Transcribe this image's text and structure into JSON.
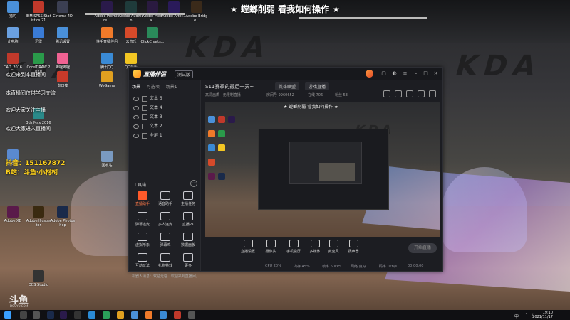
{
  "banner": "★ 螳螂削弱 看我如何操作 ★",
  "desktop_icons": [
    {
      "label": "猎豹",
      "color": "#4a90d9"
    },
    {
      "label": "IBM SPSS Statistics 21",
      "color": "#c0392b"
    },
    {
      "label": "Cinema 4D",
      "color": "#3b3f52"
    },
    {
      "label": "Adobe Premiere...",
      "color": "#2a1a4a"
    },
    {
      "label": "Adobe Audition",
      "color": "#1f3b3b"
    },
    {
      "label": "Adobe Media...",
      "color": "#2a1a40"
    },
    {
      "label": "Adobe After...",
      "color": "#2a1a5a"
    },
    {
      "label": "Adobe Bridge...",
      "color": "#3a2a1a"
    },
    {
      "label": "此电脑",
      "color": "#6aa0e0"
    },
    {
      "label": "迅雷",
      "color": "#3a7bd5"
    },
    {
      "label": "腾讯设置",
      "color": "#4a90d9"
    },
    {
      "label": "快手直播伴侣",
      "color": "#f07a2a"
    },
    {
      "label": "云音乐",
      "color": "#d64a2a"
    },
    {
      "label": "ClickCharts...",
      "color": "#2a8a5a"
    },
    {
      "label": "CAD_2016",
      "color": "#c0392b"
    },
    {
      "label": "CorelDRAW 2020",
      "color": "#2a9a4a"
    },
    {
      "label": "哔哩哔哩",
      "color": "#f06292"
    },
    {
      "label": "腾讯QQ",
      "color": "#3a8ad5"
    },
    {
      "label": "QQ音乐",
      "color": "#f3c623"
    },
    {
      "label": "3ds Max 2016",
      "color": "#2a8a8a"
    },
    {
      "label": "WeGame",
      "color": "#e0a020"
    },
    {
      "label": "向日葵",
      "color": "#c83a2a"
    },
    {
      "label": "计算机",
      "color": "#5a8ad0"
    },
    {
      "label": "回收站",
      "color": "#7a9ac0"
    },
    {
      "label": "Adobe XD",
      "color": "#5a1a4a"
    },
    {
      "label": "Adobe Illustrator",
      "color": "#3a2a10"
    },
    {
      "label": "Adobe Photoshop",
      "color": "#1a2a4a"
    },
    {
      "label": "OBS Studio",
      "color": "#333333"
    }
  ],
  "overlay": {
    "line1": "欢迎来到本直播间",
    "line2": "本直播间仅供学习交流",
    "line3": "欢迎大家关注主播",
    "line4": "欢迎大家进入直播间",
    "douyin": "抖音：151167872",
    "douyu_room": "B站：斗鱼·小柯柯"
  },
  "app": {
    "title": "直播伴侣",
    "version": "测试版",
    "left_tabs": [
      "场景",
      "可选项",
      "场景1"
    ],
    "add_label": "+",
    "scenes": [
      "文本 5",
      "文本 4",
      "文本 3",
      "文本 2",
      "全屏 1"
    ],
    "tools_header": "工具箱",
    "tools_more": "⋯",
    "tools": [
      {
        "label": "直播助手",
        "hot": true
      },
      {
        "label": "语音助手",
        "hot": false
      },
      {
        "label": "主播任务",
        "hot": false
      },
      {
        "label": "弹幕连麦",
        "hot": false
      },
      {
        "label": "多人连麦",
        "hot": false
      },
      {
        "label": "直播PK",
        "hot": false
      },
      {
        "label": "虚拟形象",
        "hot": false
      },
      {
        "label": "弹幕鸡",
        "hot": false
      },
      {
        "label": "数据面板",
        "hot": false
      },
      {
        "label": "互动玩法",
        "hot": false
      },
      {
        "label": "礼物特效",
        "hot": false
      },
      {
        "label": "更多",
        "hot": false
      }
    ],
    "tip": "机器人消息：欢迎光临...欢迎来到直播间，期待你的关注",
    "room_title": "S11赛季的最后一天~",
    "tag1": "英雄联盟",
    "tag2": "游戏直播",
    "room_info": "高清画质 · 无限制直播",
    "room_id": "房间号 9960652",
    "viewers": "在线 706",
    "fans": "粉丝 53",
    "preview_text": "★ 螳螂削弱 看我如何操作 ★",
    "preview_kda": "KDA",
    "bottom_buttons": [
      "直播设置",
      "摄像头",
      "手机投屏",
      "多媒体",
      "麦克风",
      "扬声器"
    ],
    "go_live": "开始直播",
    "status": [
      "CPU 20%",
      "内存 45%",
      "帧率 60FPS",
      "网络 良好",
      "码率 0kb/s",
      "00:00:00"
    ]
  },
  "wallpaper_logo": "KDA",
  "watermark": "斗鱼",
  "watermark_sub": "DOUYU.COM",
  "clock": {
    "time": "19:10",
    "date": "2021/11/17"
  },
  "tray": [
    "中",
    "⌃",
    "♪"
  ]
}
